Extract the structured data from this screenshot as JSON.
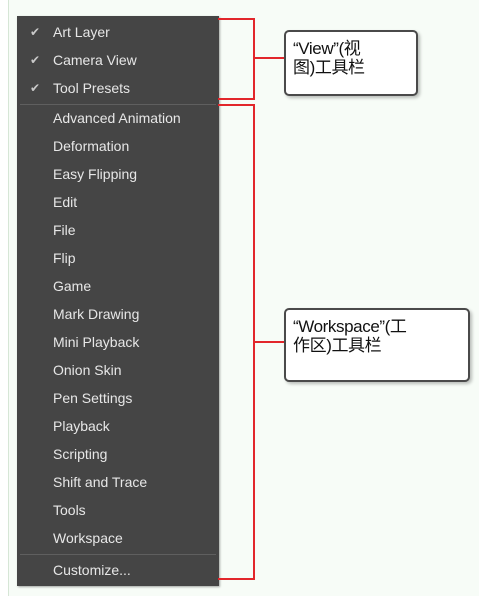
{
  "menu": {
    "view_items": [
      {
        "label": "Art Layer",
        "checked": true
      },
      {
        "label": "Camera View",
        "checked": true
      },
      {
        "label": "Tool Presets",
        "checked": true
      }
    ],
    "workspace_items": [
      {
        "label": "Advanced Animation"
      },
      {
        "label": "Deformation"
      },
      {
        "label": "Easy Flipping"
      },
      {
        "label": "Edit"
      },
      {
        "label": "File"
      },
      {
        "label": "Flip"
      },
      {
        "label": "Game"
      },
      {
        "label": "Mark Drawing"
      },
      {
        "label": "Mini Playback"
      },
      {
        "label": "Onion Skin"
      },
      {
        "label": "Pen Settings"
      },
      {
        "label": "Playback"
      },
      {
        "label": "Scripting"
      },
      {
        "label": "Shift and Trace"
      },
      {
        "label": "Tools"
      },
      {
        "label": "Workspace"
      }
    ],
    "customize_label": "Customize...",
    "check_glyph": "✔"
  },
  "callouts": {
    "view": {
      "line1": "“View”(视",
      "line2": "图)工具栏"
    },
    "workspace": {
      "line1": "“Workspace”(工",
      "line2": "作区)工具栏"
    }
  },
  "colors": {
    "menu_bg": "#454545",
    "menu_text": "#e7e7e7",
    "bracket": "#e2262b",
    "page_bg": "#f7fcf7"
  }
}
